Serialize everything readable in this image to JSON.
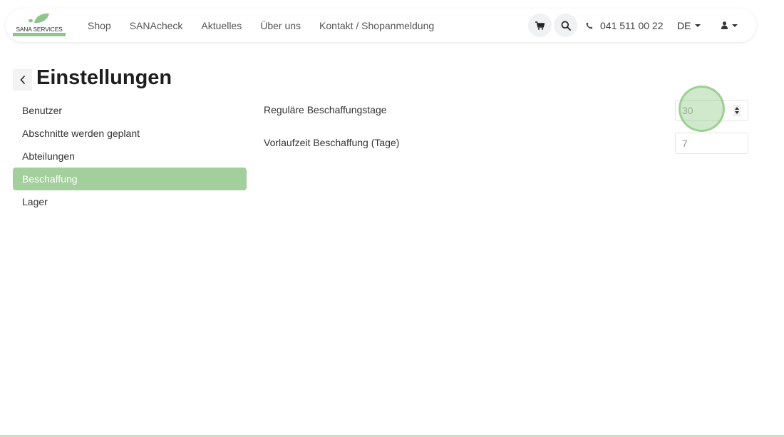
{
  "brand": {
    "name": "SANA SERVICES",
    "accent": "#8fc58a"
  },
  "nav": {
    "links": [
      "Shop",
      "SANAcheck",
      "Aktuelles",
      "Über uns",
      "Kontakt / Shopanmeldung"
    ],
    "cart_icon": "cart-icon",
    "search_icon": "search-icon",
    "phone": "041 511 00 22",
    "language": "DE",
    "user_icon": "user-icon"
  },
  "page": {
    "title": "Einstellungen",
    "back_icon": "chevron-left-icon"
  },
  "sidebar": {
    "items": [
      {
        "label": "Benutzer",
        "active": false
      },
      {
        "label": "Abschnitte werden geplant",
        "active": false
      },
      {
        "label": "Abteilungen",
        "active": false
      },
      {
        "label": "Beschaffung",
        "active": true
      },
      {
        "label": "Lager",
        "active": false
      }
    ],
    "active_color": "#a3cf9c"
  },
  "form": {
    "fields": [
      {
        "label": "Reguläre Beschaffungstage",
        "value": "30"
      },
      {
        "label": "Vorlaufzeit Beschaffung (Tage)",
        "value": "7"
      }
    ]
  }
}
